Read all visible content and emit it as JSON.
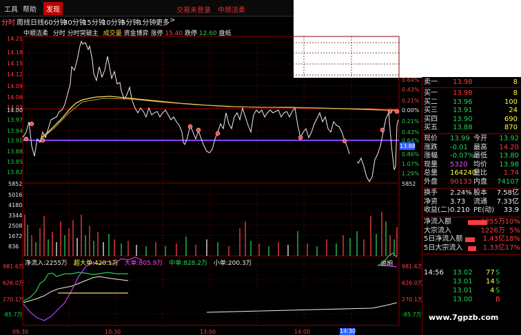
{
  "menu": {
    "items": [
      "工具",
      "帮助",
      "发现"
    ],
    "active": 2
  },
  "top_title": {
    "left": "交易未登录",
    "right": "中顺洁柔"
  },
  "tabs": [
    "分时",
    "周线",
    "日线",
    "60分钟",
    "30分钟",
    "15分钟",
    "10分钟",
    "5分钟",
    "1分钟",
    "更多"
  ],
  "tabs_more": ">",
  "info": {
    "name": "中顺洁柔",
    "type": "分时",
    "subtype": "分时突破主",
    "vol_label": "成交量",
    "fund_label": "资金博弈",
    "up_label": "涨停",
    "up_value": "15.40",
    "down_label": "跌停",
    "down_value": "12.60",
    "extra": "盘纸"
  },
  "price_axis": [
    "14.21",
    "14.18",
    "14.15",
    "14.12",
    "14.09",
    "14.06",
    "14.03",
    "14.00",
    "13.97",
    "13.94",
    "13.91",
    "13.88",
    "13.85",
    "13.82"
  ],
  "pct_axis_right": [
    "0.64%",
    "0.43%",
    "0.21%",
    "0.00%",
    "0.21%",
    "0.43%",
    "0.64%",
    "0.86%",
    "1.07%",
    "1.29%"
  ],
  "vol_axis": [
    "5852",
    "5016",
    "4180",
    "3344",
    "2508",
    "1672",
    "836"
  ],
  "vol_axis_right": [
    "5852"
  ],
  "fund_info": {
    "net": "净流入:2255万",
    "super": "超大单:420.1万",
    "big": "大单:805.9万",
    "mid": "中单:828.2万",
    "small": "小单:200.3万",
    "explain": "说明"
  },
  "fund_axis": [
    "981.6万",
    "626.0万",
    "270.1万",
    "-85.7万"
  ],
  "time_axis": [
    "09:30",
    "10:30",
    "13:00",
    "14:00"
  ],
  "price_tag": "13.88",
  "time_tag": "14:30",
  "quote": {
    "asks": [
      {
        "label": "卖一",
        "price": "13.98",
        "vol": "8"
      },
      {
        "label": "买一",
        "price": "13.98",
        "vol": "8"
      },
      {
        "label": "买二",
        "price": "13.96",
        "vol": "100"
      },
      {
        "label": "买三",
        "price": "13.91",
        "vol": "24"
      },
      {
        "label": "买四",
        "price": "13.90",
        "vol": "690"
      },
      {
        "label": "买五",
        "price": "13.88",
        "vol": "870"
      }
    ],
    "stats": [
      {
        "l1": "现价",
        "v1": "13.99",
        "l2": "今开",
        "v2": "13.92"
      },
      {
        "l1": "涨跌",
        "v1": "-0.01",
        "l2": "最高",
        "v2": "14.20"
      },
      {
        "l1": "涨幅",
        "v1": "-0.07%",
        "l2": "最低",
        "v2": "13.80"
      },
      {
        "l1": "现量",
        "v1": "5320",
        "l2": "均价",
        "v2": "13.98"
      },
      {
        "l1": "总量",
        "v1": "164240",
        "l2": "量比",
        "v2": "1.74"
      },
      {
        "l1": "外盘",
        "v1": "90133",
        "l2": "内盘",
        "v2": "74107"
      },
      {
        "l1": "换手",
        "v1": "2.24%",
        "l2": "股本",
        "v2": "7.58亿"
      },
      {
        "l1": "净资",
        "v1": "3.73",
        "l2": "流通",
        "v2": "7.33亿"
      },
      {
        "l1": "收益(二)",
        "v1": "0.210",
        "l2": "PE(动)",
        "v2": "33.9"
      }
    ],
    "flows": [
      {
        "label": "净流入额",
        "value": "2255万",
        "pct": "10%"
      },
      {
        "label": "大宗流入",
        "value": "1226万",
        "pct": "5%"
      },
      {
        "label": "5日净流入额",
        "value": "1.43亿",
        "pct": "18%"
      },
      {
        "label": "5日大宗流入",
        "value": "1.33亿",
        "pct": "17%"
      }
    ],
    "ticks": [
      {
        "time": "14:56",
        "price": "13.99",
        "vol": "",
        "flag": ""
      },
      {
        "time": "",
        "price": "13.02",
        "vol": "77",
        "flag": "S"
      },
      {
        "time": "",
        "price": "13.01",
        "vol": "14",
        "flag": "S"
      },
      {
        "time": "",
        "price": "13.01",
        "vol": "4",
        "flag": "S"
      },
      {
        "time": "",
        "price": "13.00",
        "vol": "",
        "flag": "B"
      }
    ]
  },
  "watermark": "www.7gpzb.com",
  "colors": {
    "up": "#ff3b3b",
    "down": "#28d050",
    "grid": "#8b0000",
    "avg": "#ffff40",
    "ref": "#9040ff"
  }
}
